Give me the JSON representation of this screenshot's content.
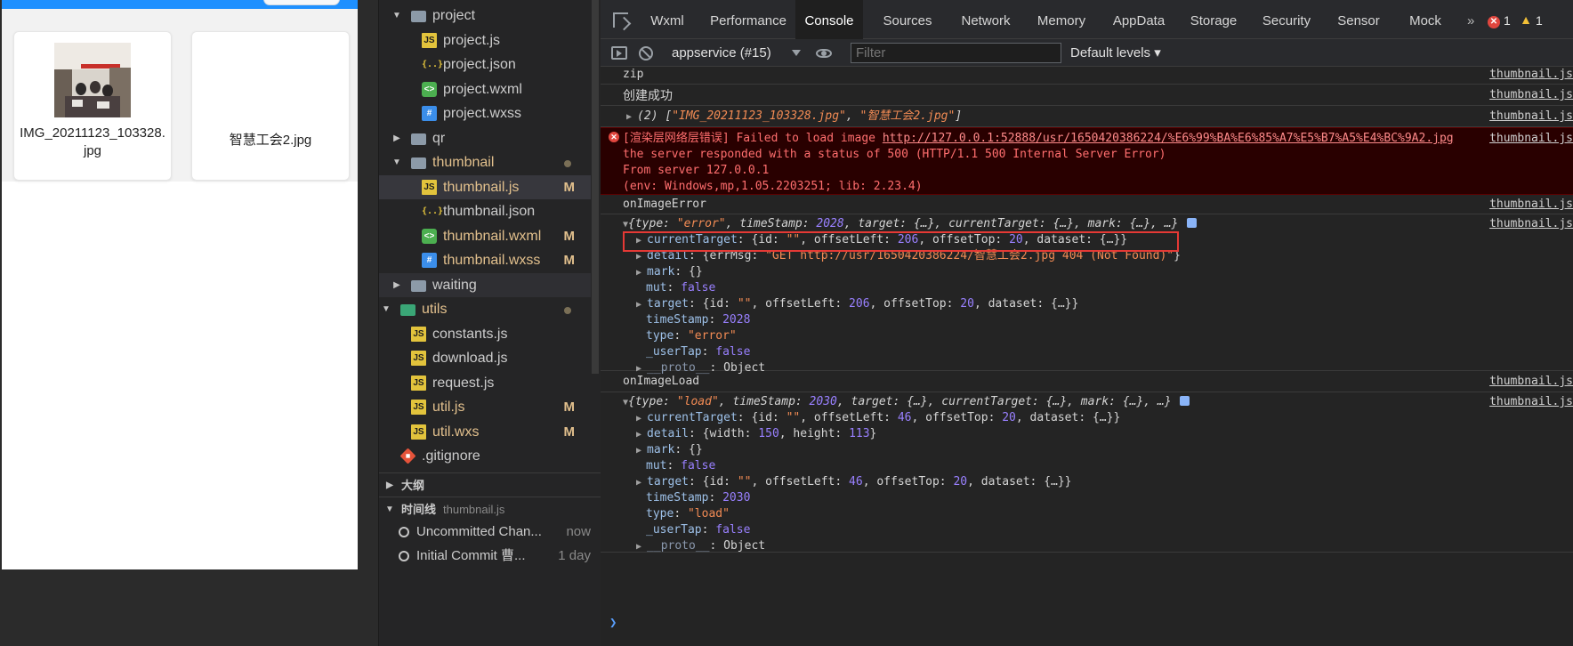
{
  "simulator": {
    "items": [
      {
        "name": "IMG_20211123_103328.jpg",
        "has_image": true
      },
      {
        "name": "智慧工会2.jpg",
        "has_image": false
      }
    ]
  },
  "explorer": {
    "rows": [
      {
        "name": "project",
        "type": "folder",
        "open": true,
        "depth": 1
      },
      {
        "name": "project.js",
        "type": "js",
        "depth": 2
      },
      {
        "name": "project.json",
        "type": "json",
        "depth": 2
      },
      {
        "name": "project.wxml",
        "type": "wxml",
        "depth": 2
      },
      {
        "name": "project.wxss",
        "type": "wxss",
        "depth": 2
      },
      {
        "name": "qr",
        "type": "folder",
        "open": false,
        "depth": 1
      },
      {
        "name": "thumbnail",
        "type": "folder",
        "open": true,
        "depth": 1,
        "modified": true,
        "dot": true
      },
      {
        "name": "thumbnail.js",
        "type": "js",
        "depth": 2,
        "modified": true,
        "badge": "M",
        "active": true
      },
      {
        "name": "thumbnail.json",
        "type": "json",
        "depth": 2
      },
      {
        "name": "thumbnail.wxml",
        "type": "wxml",
        "depth": 2,
        "modified": true,
        "badge": "M"
      },
      {
        "name": "thumbnail.wxss",
        "type": "wxss",
        "depth": 2,
        "modified": true,
        "badge": "M"
      },
      {
        "name": "waiting",
        "type": "folder",
        "open": false,
        "depth": 1,
        "hover": true
      },
      {
        "name": "utils",
        "type": "folder-green",
        "open": true,
        "depth": 0,
        "modified": true,
        "dot": true
      },
      {
        "name": "constants.js",
        "type": "js",
        "depth": 1
      },
      {
        "name": "download.js",
        "type": "js",
        "depth": 1
      },
      {
        "name": "request.js",
        "type": "js",
        "depth": 1
      },
      {
        "name": "util.js",
        "type": "js",
        "depth": 1,
        "modified": true,
        "badge": "M"
      },
      {
        "name": "util.wxs",
        "type": "js",
        "depth": 1,
        "modified": true,
        "badge": "M"
      },
      {
        "name": ".gitignore",
        "type": "git",
        "depth": 0
      }
    ],
    "outline_label": "大纲",
    "timeline_label": "时间线",
    "timeline_file": "thumbnail.js",
    "timeline_items": [
      {
        "label": "Uncommitted Chan...",
        "time": "now"
      },
      {
        "label": "Initial Commit 曹...",
        "time": "1 day"
      }
    ]
  },
  "devtools": {
    "tabs": [
      "Wxml",
      "Performance",
      "Console",
      "Sources",
      "Network",
      "Memory",
      "AppData",
      "Storage",
      "Security",
      "Sensor",
      "Mock"
    ],
    "active_tab": "Console",
    "more": "»",
    "error_count": "1",
    "warning_count": "1",
    "context": "appservice (#15)",
    "filter_placeholder": "Filter",
    "levels": "Default levels ▾",
    "source": "thumbnail.js",
    "log": {
      "zip": "zip",
      "created": "创建成功",
      "array_prefix": "(2) [",
      "array_item1": "\"IMG_20211123_103328.jpg\"",
      "array_sep": ", ",
      "array_item2": "\"智慧工会2.jpg\"",
      "array_suffix": "]",
      "err_prefix": "[渲染层网络层错误] Failed to load image ",
      "err_url": "http://127.0.0.1:52888/usr/1650420386224/%E6%99%BA%E6%85%A7%E5%B7%A5%E4%BC%9A2.jpg",
      "err_line2": "the server responded with a status of 500 (HTTP/1.1 500 Internal Server Error)",
      "err_line3": "From server 127.0.0.1",
      "err_line4": "(env: Windows,mp,1.05.2203251; lib: 2.23.4)",
      "on_image_error": "onImageError",
      "on_image_load": "onImageLoad"
    }
  }
}
